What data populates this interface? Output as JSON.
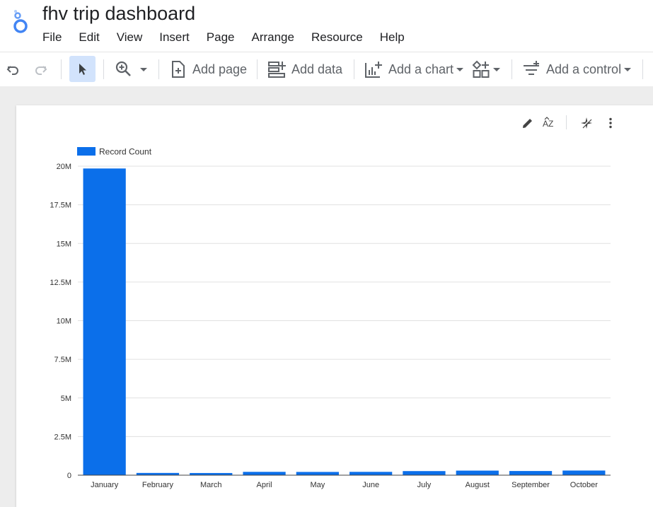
{
  "header": {
    "title": "fhv trip dashboard",
    "menu": [
      "File",
      "Edit",
      "View",
      "Insert",
      "Page",
      "Arrange",
      "Resource",
      "Help"
    ]
  },
  "toolbar": {
    "add_page_label": "Add page",
    "add_data_label": "Add data",
    "add_chart_label": "Add a chart",
    "add_control_label": "Add a control"
  },
  "icons": {
    "logo": "looker-studio-logo-icon",
    "undo": "undo-icon",
    "redo": "redo-icon",
    "select": "cursor-icon",
    "zoom": "zoom-in-icon",
    "add_page": "add-page-icon",
    "add_data": "add-data-icon",
    "add_chart": "add-chart-icon",
    "add_component": "components-icon",
    "add_control": "filter-control-icon",
    "edit": "pencil-icon",
    "sort": "sort-az-icon",
    "explore": "sparkle-icon",
    "more": "more-vert-icon"
  },
  "colors": {
    "bar": "#0b6fea",
    "accent": "#1a73e8",
    "grid": "#e0e0e0"
  },
  "chart_data": {
    "type": "bar",
    "categories": [
      "January",
      "February",
      "March",
      "April",
      "May",
      "June",
      "July",
      "August",
      "September",
      "October"
    ],
    "series": [
      {
        "name": "Record Count",
        "values": [
          19850000,
          145000,
          140000,
          215000,
          210000,
          215000,
          265000,
          295000,
          270000,
          300000
        ]
      }
    ],
    "ylim": [
      0,
      20000000
    ],
    "yticks": [
      {
        "value": 0,
        "label": "0"
      },
      {
        "value": 2500000,
        "label": "2.5M"
      },
      {
        "value": 5000000,
        "label": "5M"
      },
      {
        "value": 7500000,
        "label": "7.5M"
      },
      {
        "value": 10000000,
        "label": "10M"
      },
      {
        "value": 12500000,
        "label": "12.5M"
      },
      {
        "value": 15000000,
        "label": "15M"
      },
      {
        "value": 17500000,
        "label": "17.5M"
      },
      {
        "value": 20000000,
        "label": "20M"
      }
    ],
    "grid": true,
    "legend": "top-left"
  }
}
